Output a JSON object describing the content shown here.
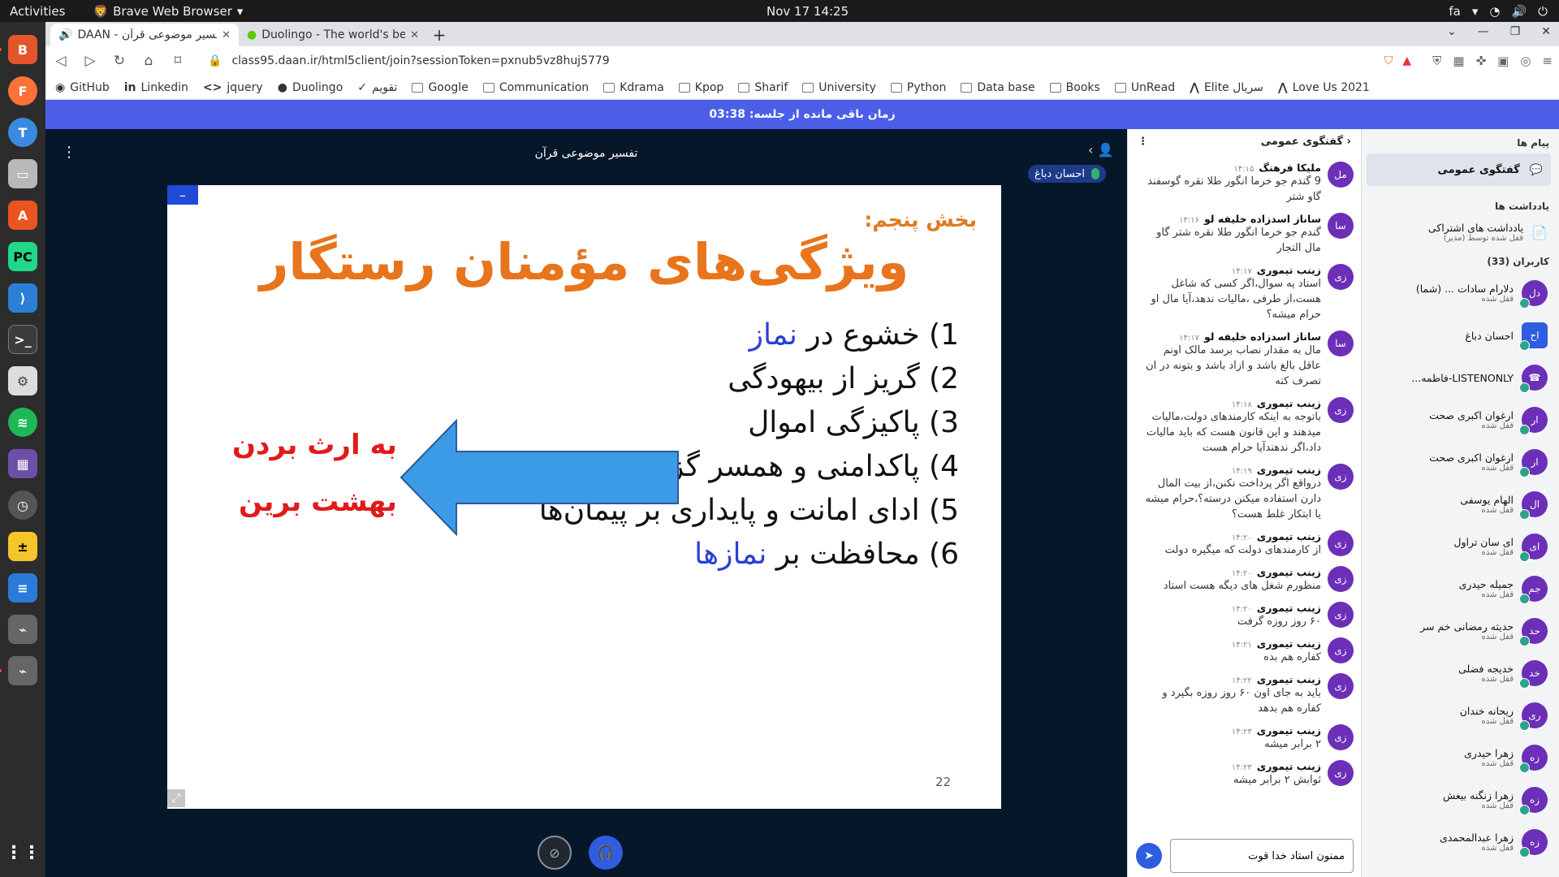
{
  "topbar": {
    "activities": "Activities",
    "app": "Brave Web Browser",
    "clock": "Nov 17  14:25",
    "lang": "fa"
  },
  "tabs": [
    {
      "title": "DAAN - تفسیر موضوعی قرآن"
    },
    {
      "title": "Duolingo - The world's best w"
    }
  ],
  "url": "class95.daan.ir/html5client/join?sessionToken=pxnub5vz8huj5779",
  "bookmarks": [
    "GitHub",
    "Linkedin",
    "jquery",
    "Duolingo",
    "تقویم",
    "Google",
    "Communication",
    "Kdrama",
    "Kpop",
    "Sharif",
    "University",
    "Python",
    "Data base",
    "Books",
    "UnRead",
    "Elite سریال",
    "Love Us 2021"
  ],
  "banner": "زمان باقی مانده از جلسه: 03:38",
  "presentation": {
    "title": "تفسیر موضوعی قرآن",
    "presenter": "احسان دباغ",
    "minimize": "–",
    "slide": {
      "section": "بخش پنجم:",
      "heading": "ویژگی‌های مؤمنان رستگار",
      "items": [
        {
          "pre": "1) خشوع در ",
          "hl": "نماز"
        },
        {
          "pre": "2) گریز از بیهودگی",
          "hl": ""
        },
        {
          "pre": "3) پاکیزگی اموال",
          "hl": ""
        },
        {
          "pre": "4) پاکدامنی و همسر گزینی",
          "hl": ""
        },
        {
          "pre": "5) ادای امانت و پایداری بر پیمان‌ها",
          "hl": ""
        },
        {
          "pre": "6) محافظت بر ",
          "hl": "نمازها"
        }
      ],
      "note1": "به ارث بردن",
      "note2": "بهشت برین",
      "page": "22",
      "arrow_color": "#3b9be6"
    }
  },
  "chat": {
    "header": "گفتگوی عمومی",
    "messages": [
      {
        "av": "مل",
        "name": "ملیکا فرهنگ",
        "time": "۱۴:۱۵",
        "text": "9 گندم جو خرما انگور طلا نقره گوسفند گاو شتر"
      },
      {
        "av": "سا",
        "name": "ساناز اسدزاده خلیفه لو",
        "time": "۱۴:۱۶",
        "text": "گندم جو خرما انگور طلا نقره شتر گاو مال التجار"
      },
      {
        "av": "زی",
        "name": "زینب تیموری",
        "time": "۱۴:۱۷",
        "text": "استاد یه سوال،اگر کسی که شاغل هست،از طرفی ،مالیات ندهد،آیا مال او حرام میشه؟"
      },
      {
        "av": "سا",
        "name": "ساناز اسدزاده خلیفه لو",
        "time": "۱۴:۱۷",
        "text": "مال به مقدار نصاب برسد مالک اونم عاقل بالغ باشد و ازاد باشد و بتونه در ان تصرف کنه"
      },
      {
        "av": "زی",
        "name": "زینب تیموری",
        "time": "۱۴:۱۸",
        "text": "باتوجه به اینکه کارمندهای دولت،مالیات میدهند و این قانون هست که باید مالیات داد،اگر ندهندآیا حرام هست"
      },
      {
        "av": "زی",
        "name": "زینب تیموری",
        "time": "۱۴:۱۹",
        "text": "درواقع اگر پرداخت نکنن،از بیت المال دارن استفاده میکنن درسته؟،حرام میشه یا ابتکار غلط هست؟"
      },
      {
        "av": "زی",
        "name": "زینب تیموری",
        "time": "۱۴:۲۰",
        "text": "از کارمندهای دولت که میگیره دولت"
      },
      {
        "av": "زی",
        "name": "زینب تیموری",
        "time": "۱۴:۲۰",
        "text": "منظورم شغل های دیگه هست استاد"
      },
      {
        "av": "زی",
        "name": "زینب تیموری",
        "time": "۱۴:۲۰",
        "text": "۶۰ روز روزه گرفت"
      },
      {
        "av": "زی",
        "name": "زینب تیموری",
        "time": "۱۴:۲۱",
        "text": "کفاره هم بده"
      },
      {
        "av": "زی",
        "name": "زینب تیموری",
        "time": "۱۴:۲۲",
        "text": "باید به جای اون ۶۰ روز روزه بگیرد و کفاره هم بدهد"
      },
      {
        "av": "زی",
        "name": "زینب تیموری",
        "time": "۱۴:۲۳",
        "text": "۲ برابر میشه"
      },
      {
        "av": "زی",
        "name": "زینب تیموری",
        "time": "۱۴:۲۳",
        "text": "ثوابش ۲ برابر میشه"
      }
    ],
    "input_value": "ممنون استاد خدا قوت"
  },
  "sidebar": {
    "messages_title": "پیام ها",
    "public_chat": "گفتگوی عمومی",
    "notes_title": "یادداشت ها",
    "shared_notes": "یادداشت های اشتراکی",
    "shared_notes_sub": "قفل شده توسط (مدیر)",
    "users_title": "کاربران (33)",
    "users": [
      {
        "av": "دل",
        "name": "دلارام سادات ... (شما)",
        "sub": "قفل شده",
        "sq": false
      },
      {
        "av": "اح",
        "name": "احسان دباغ",
        "sub": "",
        "sq": true
      },
      {
        "av": "☎",
        "name": "LISTENONLY-فاطمه...",
        "sub": "",
        "sq": false
      },
      {
        "av": "ار",
        "name": "ارغوان اکبری صحت",
        "sub": "قفل شده",
        "sq": false
      },
      {
        "av": "ار",
        "name": "ارغوان اکبری صحت",
        "sub": "قفل شده",
        "sq": false
      },
      {
        "av": "ال",
        "name": "الهام یوسفی",
        "sub": "قفل شده",
        "sq": false
      },
      {
        "av": "ای",
        "name": "ای سان تراول",
        "sub": "قفل شده",
        "sq": false
      },
      {
        "av": "جم",
        "name": "جمیله حیدری",
        "sub": "قفل شده",
        "sq": false
      },
      {
        "av": "حد",
        "name": "حدیثه رمضانی خم سر",
        "sub": "قفل شده",
        "sq": false
      },
      {
        "av": "خد",
        "name": "خدیجه فضلی",
        "sub": "قفل شده",
        "sq": false
      },
      {
        "av": "ری",
        "name": "ریحانه خندان",
        "sub": "قفل شده",
        "sq": false
      },
      {
        "av": "زه",
        "name": "زهرا حیدری",
        "sub": "قفل شده",
        "sq": false
      },
      {
        "av": "زه",
        "name": "زهرا زنگنه بیغش",
        "sub": "قفل شده",
        "sq": false
      },
      {
        "av": "زه",
        "name": "زهرا عبدالمحمدی",
        "sub": "قفل شده",
        "sq": false
      }
    ]
  }
}
